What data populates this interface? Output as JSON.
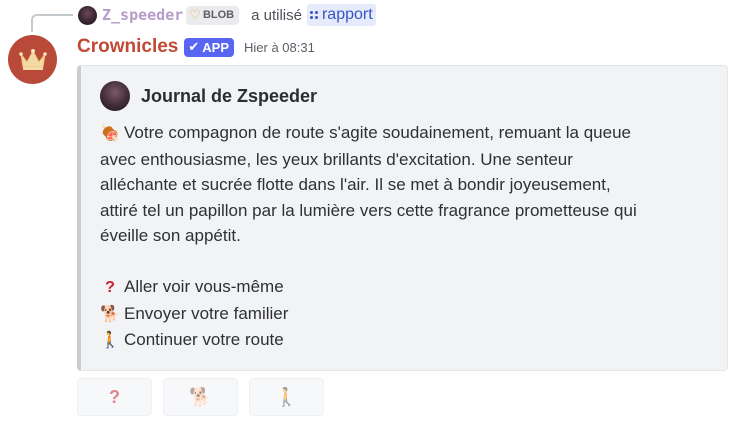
{
  "reply": {
    "username": "Z_speeder",
    "tag": "BLOB",
    "tag_icon": "heart-icon",
    "verb": "a utilisé",
    "command": "rapport",
    "command_icon": "slash-command-icon"
  },
  "message": {
    "bot_name": "Crownicles",
    "badge": "APP",
    "badge_icon": "checkmark-icon",
    "timestamp": "Hier à 08:31",
    "bot_color": "#c04a35",
    "avatar_icon": "crown-icon"
  },
  "embed": {
    "author": "Journal de Zspeeder",
    "description_lines": [
      "Votre compagnon de route s'agite soudainement, remuant la queue",
      "avec enthousiasme, les yeux brillants d'excitation. Une senteur",
      "alléchante et sucrée flotte dans l'air. Il se met à bondir joyeusement,",
      "attiré tel un papillon par la lumière vers cette fragrance prometteuse qui",
      "éveille son appétit."
    ],
    "lead_emoji": "meat-on-bone-icon",
    "options": [
      {
        "emoji": "question-mark-icon",
        "label": "Aller voir vous-même"
      },
      {
        "emoji": "service-dog-icon",
        "label": "Envoyer votre familier"
      },
      {
        "emoji": "person-walking-icon",
        "label": "Continuer votre route"
      }
    ]
  },
  "buttons": [
    {
      "icon": "question-mark-icon",
      "disabled": true
    },
    {
      "icon": "service-dog-icon",
      "disabled": true
    },
    {
      "icon": "person-walking-icon",
      "disabled": true
    }
  ]
}
